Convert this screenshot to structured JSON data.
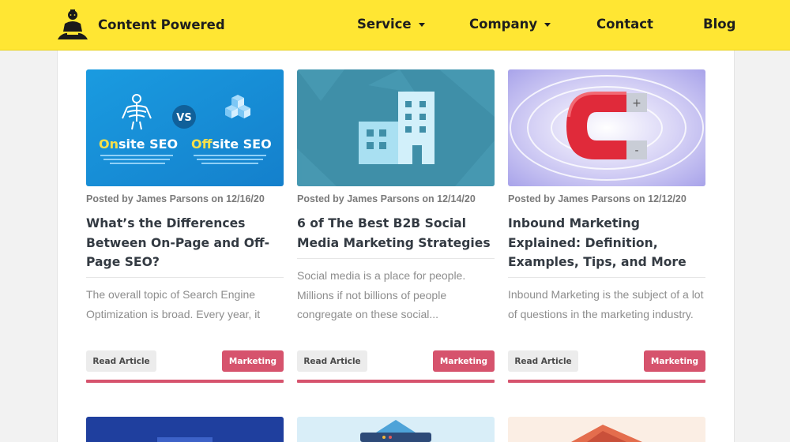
{
  "header": {
    "brand_name": "Content Powered",
    "nav": [
      {
        "label": "Service",
        "has_dropdown": true
      },
      {
        "label": "Company",
        "has_dropdown": true
      },
      {
        "label": "Contact",
        "has_dropdown": false
      },
      {
        "label": "Blog",
        "has_dropdown": false
      }
    ]
  },
  "colors": {
    "header_bg": "#ffe633",
    "accent": "#d6536d",
    "button_gray": "#ececec"
  },
  "posts": [
    {
      "thumb_text": {
        "vs": "VS",
        "left_label_a": "On",
        "left_label_b": "site SEO",
        "right_label_a": "Off",
        "right_label_b": "site SEO"
      },
      "meta": "Posted by James Parsons on 12/16/20",
      "title": "What’s the Differences Between On-Page and Off-Page SEO?",
      "excerpt": "The overall topic of Search Engine Optimization is broad. Every year, it",
      "read_label": "Read Article",
      "category": "Marketing"
    },
    {
      "meta": "Posted by James Parsons on 12/14/20",
      "title": "6 of The Best B2B Social Media Marketing Strategies",
      "excerpt": "Social media is a place for people. Millions if not billions of people congregate on these social...",
      "read_label": "Read Article",
      "category": "Marketing"
    },
    {
      "meta": "Posted by James Parsons on 12/12/20",
      "title": "Inbound Marketing Explained: Definition, Examples, Tips, and More",
      "excerpt": "Inbound Marketing is the subject of a lot of questions in the marketing industry.",
      "read_label": "Read Article",
      "category": "Marketing"
    }
  ]
}
